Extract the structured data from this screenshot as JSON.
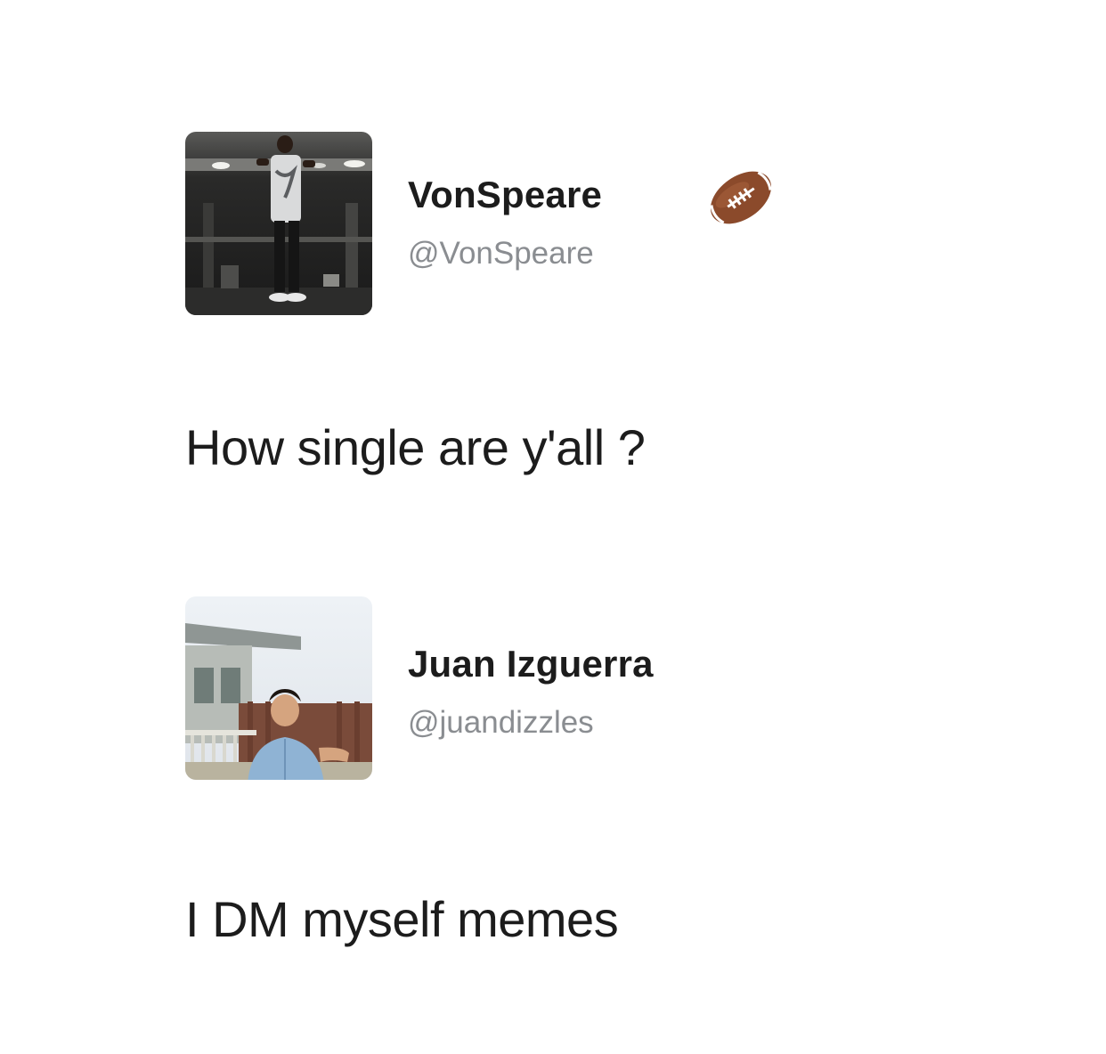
{
  "tweets": [
    {
      "display_name": "VonSpeare",
      "handle": "@VonSpeare",
      "badge_icon": "football-emoji-icon",
      "text": "How single are y'all ?",
      "avatar_icon": "avatar-photo-person-standing-at-night"
    },
    {
      "display_name": "Juan Izguerra",
      "handle": "@juandizzles",
      "text": "I DM myself memes",
      "avatar_icon": "avatar-photo-person-outdoors-by-fence"
    }
  ],
  "colors": {
    "background": "#ffffff",
    "name": "#1c1c1c",
    "handle": "#8a8d91",
    "football": "#8b4a2b"
  }
}
